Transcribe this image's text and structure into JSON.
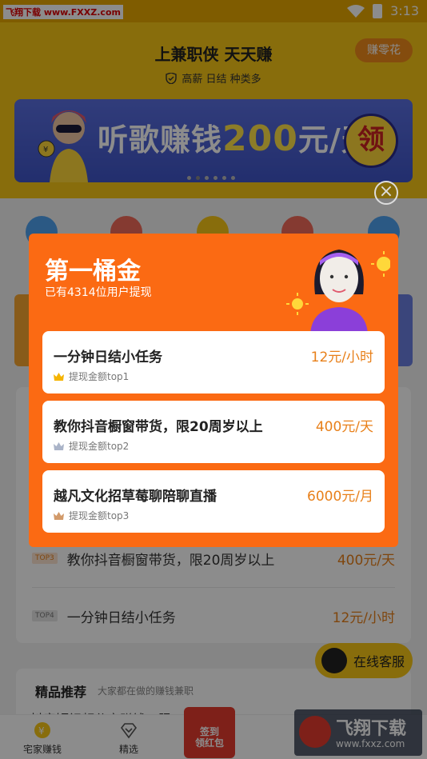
{
  "status": {
    "watermark": "飞翔下载 www.FXXZ.com",
    "time": "3:13"
  },
  "header": {
    "title": "上兼职侠 天天赚",
    "subtitle": "高薪 日结 种类多",
    "earn_button": "赚零花"
  },
  "banner": {
    "text_prefix": "听歌赚钱",
    "amount": "200",
    "text_suffix": "元/天",
    "get_label": "领"
  },
  "background_list": {
    "items": [
      {
        "tag": "TOP3",
        "title": "教你抖音橱窗带货，限20周岁以上",
        "price": "400元/天"
      },
      {
        "tag": "TOP4",
        "title": "一分钟日结小任务",
        "price": "12元/小时"
      }
    ]
  },
  "service": {
    "label": "在线客服"
  },
  "recommend": {
    "title": "精品推荐",
    "subtitle": "大家都在做的赚钱兼职",
    "peek": "抖音短视频分享赚钱，限20"
  },
  "tabbar": {
    "tabs": [
      {
        "label": "宅家赚钱"
      },
      {
        "label": "精选"
      }
    ],
    "redpacket": {
      "line1": "签到",
      "line2": "领红包"
    }
  },
  "watermark_br": {
    "title": "飞翔下载",
    "url": "www.fxxz.com"
  },
  "modal": {
    "title": "第一桶金",
    "subtitle": "已有4314位用户提现",
    "close": "×",
    "tasks": [
      {
        "title": "一分钟日结小任务",
        "price": "12元/小时",
        "rank": "提现金额top1",
        "crown_color": "#f5b400"
      },
      {
        "title": "教你抖音橱窗带货，限20周岁以上",
        "price": "400元/天",
        "rank": "提现金额top2",
        "crown_color": "#aab4c8"
      },
      {
        "title": "越凡文化招草莓聊陪聊直播",
        "price": "6000元/月",
        "rank": "提现金额top3",
        "crown_color": "#d29a6a"
      }
    ]
  }
}
